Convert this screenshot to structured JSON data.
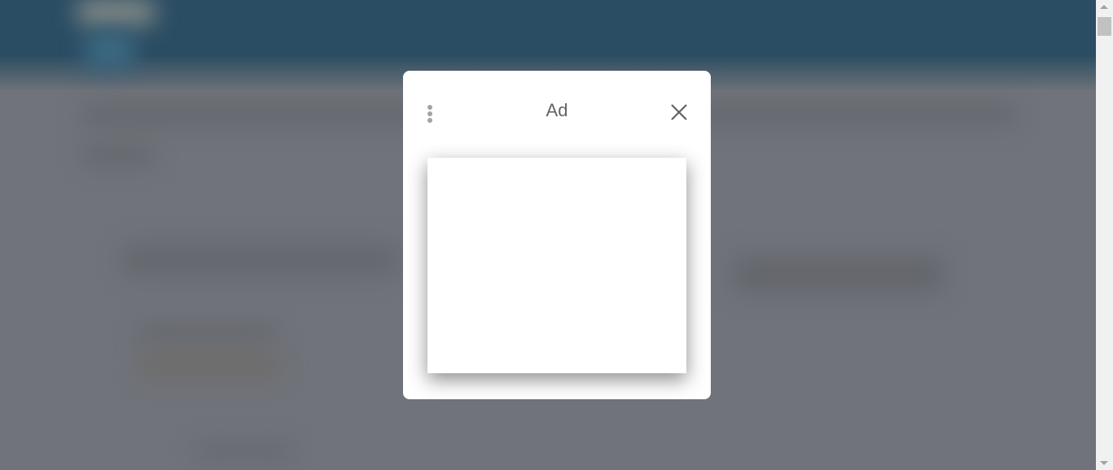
{
  "modal": {
    "title": "Ad",
    "menu_icon": "more-vert-icon",
    "close_icon": "close-icon"
  },
  "colors": {
    "header": "#2b4d63",
    "overlay": "#70737a",
    "modal_background": "#ffffff",
    "title_text": "#5f6368"
  }
}
